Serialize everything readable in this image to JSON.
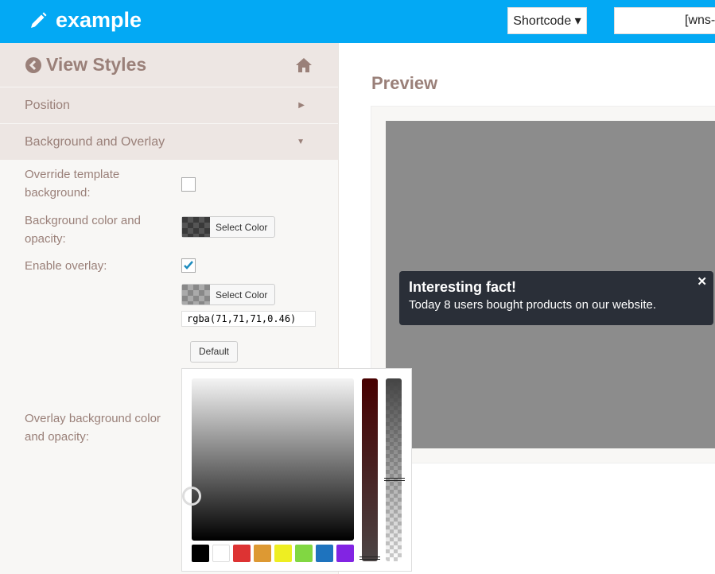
{
  "header": {
    "title": "example",
    "icon": "pencil-icon",
    "shortcode_label": "Shortcode ▾",
    "shortcode_value": "[wns-"
  },
  "sidebar": {
    "title": "View Styles",
    "sections": [
      {
        "label": "Position",
        "state": "collapsed"
      },
      {
        "label": "Background and Overlay",
        "state": "expanded"
      }
    ],
    "fields": {
      "override_label": "Override template background:",
      "override_checked": false,
      "bg_label": "Background color and opacity:",
      "select_color": "Select Color",
      "overlay_label": "Enable overlay:",
      "overlay_checked": true,
      "overlay_color_label": "Overlay background color and opacity:",
      "rgba_value": "rgba(71,71,71,0.46)",
      "default_label": "Default"
    }
  },
  "picker": {
    "palette": [
      "#000000",
      "#ffffff",
      "#dd3333",
      "#dd9933",
      "#eeee22",
      "#81d742",
      "#1e73be",
      "#8224e3"
    ]
  },
  "preview": {
    "title": "Preview",
    "toast_title": "Interesting fact!",
    "toast_text": "Today 8 users bought products on our website.",
    "close": "✕"
  },
  "colors": {
    "accent": "#03a9f4",
    "label": "#9a8079"
  }
}
